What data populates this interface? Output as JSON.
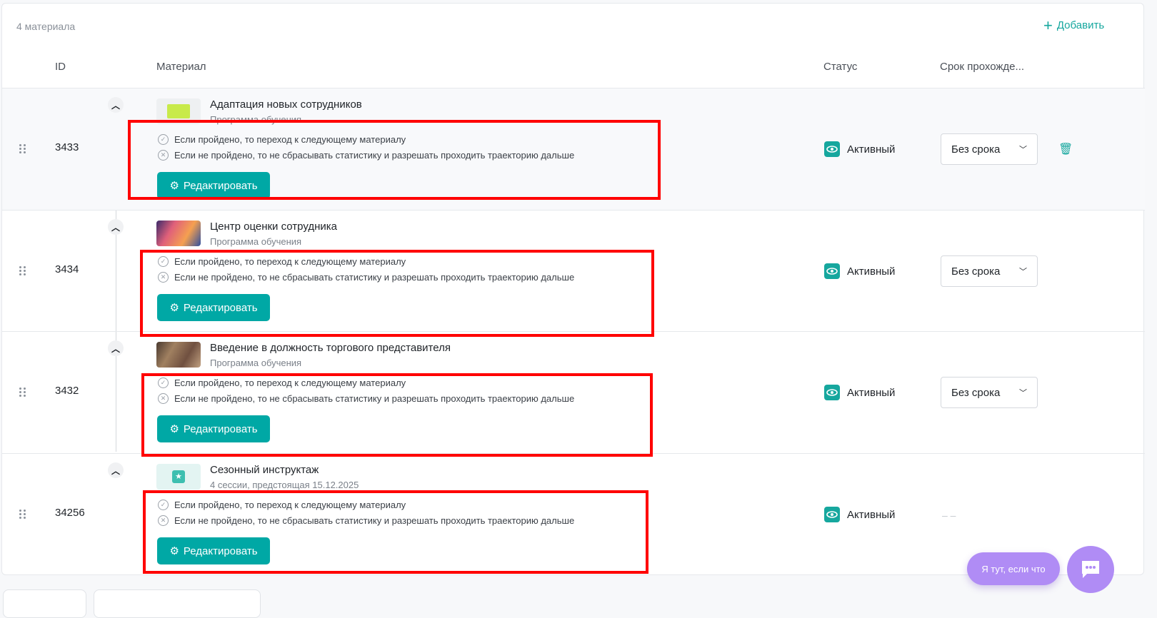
{
  "header": {
    "count": "4 материала",
    "add_label": "Добавить"
  },
  "columns": {
    "id": "ID",
    "material": "Материал",
    "status": "Статус",
    "deadline": "Срок прохожде..."
  },
  "rule_pass": "Если пройдено, то переход к следующему материалу",
  "rule_fail": "Если не пройдено, то не сбрасывать статистику и разрешать проходить траекторию дальше",
  "edit_label": "Редактировать",
  "rows": [
    {
      "id": "3433",
      "title": "Адаптация новых сотрудников",
      "subtitle": "Программа обучения",
      "status": "Активный",
      "deadline": "Без срока"
    },
    {
      "id": "3434",
      "title": "Центр оценки сотрудника",
      "subtitle": "Программа обучения",
      "status": "Активный",
      "deadline": "Без срока"
    },
    {
      "id": "3432",
      "title": "Введение в должность торгового представителя",
      "subtitle": "Программа обучения",
      "status": "Активный",
      "deadline": "Без срока"
    },
    {
      "id": "34256",
      "title": "Сезонный инструктаж",
      "subtitle": "4 сессии, предстоящая 15.12.2025",
      "status": "Активный",
      "deadline": "– –"
    }
  ],
  "chat": {
    "label": "Я тут, если что"
  },
  "colors": {
    "accent": "#00a8a5",
    "chat": "#b08cf5",
    "highlight": "#ff0000"
  }
}
